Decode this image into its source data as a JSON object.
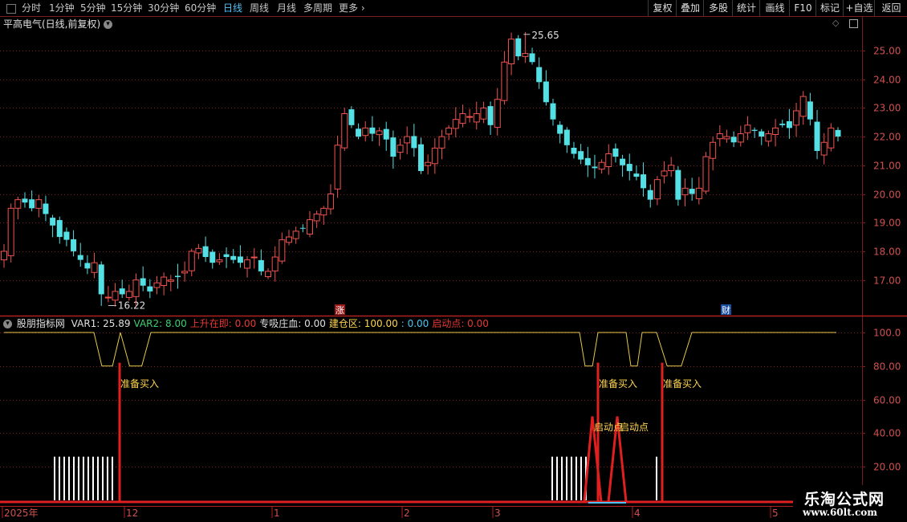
{
  "toolbar": {
    "timeframes": [
      "分时",
      "1分钟",
      "5分钟",
      "15分钟",
      "30分钟",
      "60分钟",
      "日线",
      "周线",
      "月线",
      "多周期",
      "更多"
    ],
    "active": "日线",
    "right_buttons": [
      "复权",
      "叠加",
      "多股",
      "统计",
      "画线",
      "F10",
      "标记",
      "+自选",
      "返回"
    ]
  },
  "main_title": "平高电气(日线,前复权)",
  "price_axis": [
    "25.00",
    "24.00",
    "23.00",
    "22.00",
    "21.00",
    "20.00",
    "19.00",
    "18.00",
    "17.00"
  ],
  "annotations": {
    "high_label": "25.65",
    "low_label": "16.22",
    "mark_up": "涨",
    "mark_fin": "财"
  },
  "indicator": {
    "title": "股朋指标网",
    "values": [
      {
        "label": "VAR1: 25.89",
        "color": "#e0e0e0"
      },
      {
        "label": "VAR2: 8.00",
        "color": "#3cd070"
      },
      {
        "label": "上升在即: 0.00",
        "color": "#e53935"
      },
      {
        "label": "专吸庄血: 0.00",
        "color": "#e0e0e0"
      },
      {
        "label": "建仓区: 100.00",
        "color": "#ffd54f"
      },
      {
        "label": ": 0.00",
        "color": "#4fc3f7"
      },
      {
        "label": "启动点: 0.00",
        "color": "#e53935"
      }
    ],
    "axis": [
      "100.0",
      "80.00",
      "60.00",
      "40.00",
      "20.00"
    ],
    "signal_buy": "准备买入",
    "signal_start": "启动点"
  },
  "date_axis": [
    "2025年",
    "12",
    "1",
    "2",
    "3",
    "4",
    "5"
  ],
  "watermark": {
    "name": "乐淘公式网",
    "url": "www.60lt.com"
  },
  "colors": {
    "up": "#ef5350",
    "down": "#54e1e6",
    "grid": "#7a1f1f",
    "yellow": "#e6c84a"
  },
  "chart_data": {
    "type": "candlestick",
    "title": "平高电气(日线,前复权)",
    "y_range": [
      16.2,
      25.7
    ],
    "high": 25.65,
    "low": 16.22,
    "closes": [
      18.0,
      19.5,
      19.8,
      19.7,
      19.5,
      19.8,
      19.3,
      18.9,
      18.5,
      18.4,
      18.0,
      17.7,
      17.4,
      17.6,
      16.5,
      16.4,
      16.6,
      16.5,
      16.6,
      17.0,
      16.8,
      16.6,
      16.9,
      17.1,
      17.0,
      17.1,
      17.3,
      18.0,
      18.1,
      17.8,
      17.6,
      17.7,
      17.8,
      17.7,
      17.6,
      17.7,
      17.8,
      17.3,
      17.3,
      17.8,
      18.4,
      18.5,
      18.7,
      18.8,
      19.1,
      19.3,
      19.5,
      20.0,
      21.7,
      22.8,
      22.4,
      22.0,
      22.3,
      22.1,
      22.2,
      21.9,
      21.3,
      21.7,
      22.0,
      21.6,
      20.8,
      21.1,
      21.6,
      22.0,
      22.3,
      22.6,
      22.8,
      22.7,
      22.8,
      23.0,
      22.4,
      23.3,
      24.6,
      25.4,
      24.8,
      24.9,
      24.6,
      23.9,
      23.2,
      22.6,
      22.1,
      21.7,
      21.4,
      21.2,
      21.0,
      20.9,
      21.1,
      21.4,
      21.3,
      21.0,
      20.8,
      20.6,
      20.2,
      19.8,
      20.5,
      20.8,
      21.0,
      19.8,
      20.2,
      20.0,
      20.2,
      21.3,
      21.8,
      22.1,
      22.0,
      21.8,
      22.1,
      22.4,
      22.2,
      22.0,
      22.1,
      22.3,
      22.4,
      22.3,
      22.9,
      23.4,
      22.6,
      21.5,
      21.8,
      22.3,
      22.0
    ],
    "indicator_line": {
      "name": "建仓区",
      "levels": [
        80,
        100
      ]
    },
    "signals": [
      "准备买入",
      "准备买入",
      "准备买入",
      "启动点",
      "启动点"
    ]
  }
}
